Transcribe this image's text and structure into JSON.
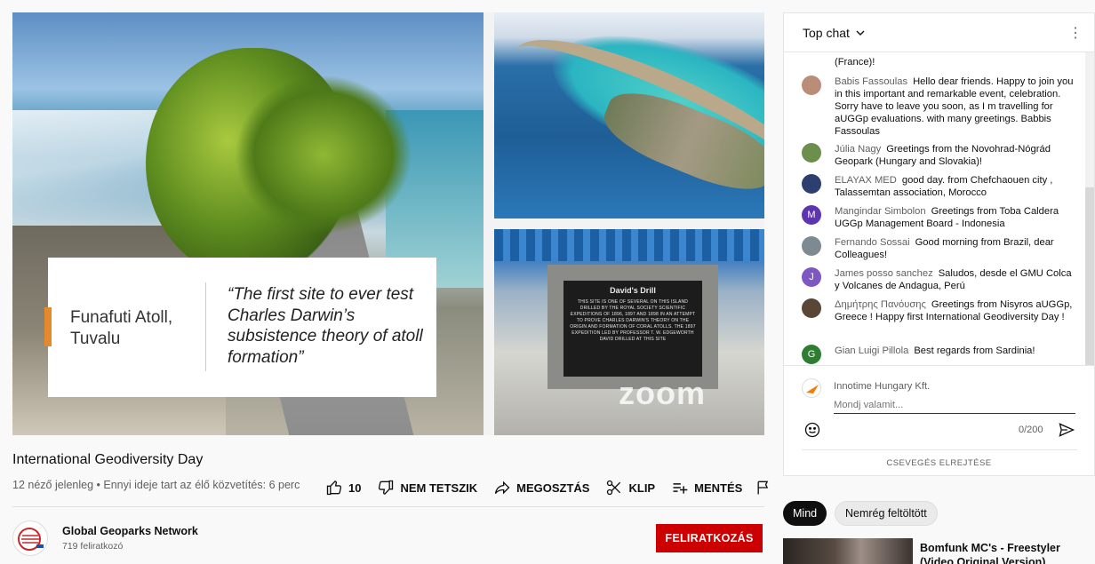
{
  "video": {
    "caption_place": "Funafuti Atoll, Tuvalu",
    "caption_quote": "“The first site to ever test Charles Darwin’s subsistence theory of atoll formation”",
    "plaque_title": "David's Drill",
    "plaque_text": "THIS SITE IS ONE OF SEVERAL ON THIS ISLAND DRILLED BY THE ROYAL SOCIETY SCIENTIFIC EXPEDITIONS OF 1896, 1897 AND 1898 IN AN ATTEMPT TO PROVE CHARLES DARWIN'S THEORY ON THE ORIGIN AND FORMATION OF CORAL ATOLLS. THE 1897 EXPEDITION LED BY PROFESSOR T. W. EDGEWORTH DAVID DRILLED AT THIS SITE",
    "watermark": "zoom"
  },
  "title": "International Geodiversity Day",
  "meta": "12 néző jelenleg • Ennyi ideje tart az élő közvetítés: 6 perc",
  "actions": {
    "like_count": "10",
    "dislike": "NEM TETSZIK",
    "share": "MEGOSZTÁS",
    "clip": "KLIP",
    "save": "MENTÉS"
  },
  "channel": {
    "name": "Global Geoparks Network",
    "subscribers": "719 feliratkozó",
    "subscribe": "FELIRATKOZÁS"
  },
  "chat": {
    "header": "Top chat",
    "partial_top": "(France)!",
    "messages": [
      {
        "author": "Babis Fassoulas",
        "text": "Hello dear friends. Happy to join you in this important and remarkable event, celebration. Sorry have to leave you soon, as I m travelling for aUGGp evaluations. with many greetings. Babbis Fassoulas",
        "avatar_color": "#b98d78",
        "initial": ""
      },
      {
        "author": "Júlia Nagy",
        "text": "Greetings from the Novohrad-Nógrád Geopark (Hungary and Slovakia)!",
        "avatar_color": "#6d8f4e",
        "initial": ""
      },
      {
        "author": "ELAYAX MED",
        "text": "good day. from Chefchaouen city , Talassemtan association, Morocco",
        "avatar_color": "#2d3f6e",
        "initial": ""
      },
      {
        "author": "Mangindar Simbolon",
        "text": "Greetings from Toba Caldera UGGp Management Board - Indonesia",
        "avatar_color": "#5e35b1",
        "initial": "M"
      },
      {
        "author": "Fernando Sossai",
        "text": "Good morning from Brazil, dear Colleagues!",
        "avatar_color": "#7d8a92",
        "initial": ""
      },
      {
        "author": "James posso sanchez",
        "text": "Saludos, desde el GMU Colca y Volcanes de Andagua, Perú",
        "avatar_color": "#7e57c2",
        "initial": "J"
      },
      {
        "author": "Δημήτρης Πανόυσης",
        "text": "Greetings from Nisyros aUGGp, Greece ! Happy first International Geodiversity Day !",
        "avatar_color": "#5a4636",
        "initial": ""
      },
      {
        "author": "Gian Luigi Pillola",
        "text": "Best regards from Sardinia!",
        "avatar_color": "#2e7d32",
        "initial": "G"
      }
    ],
    "current_user": "Innotime Hungary Kft.",
    "input_placeholder": "Mondj valamit...",
    "counter": "0/200",
    "hide": "CSEVEGÉS ELREJTÉSE"
  },
  "chips": {
    "all": "Mind",
    "recent": "Nemrég feltöltött"
  },
  "recommended": {
    "title": "Bomfunk MC's - Freestyler (Video Original Version)"
  }
}
